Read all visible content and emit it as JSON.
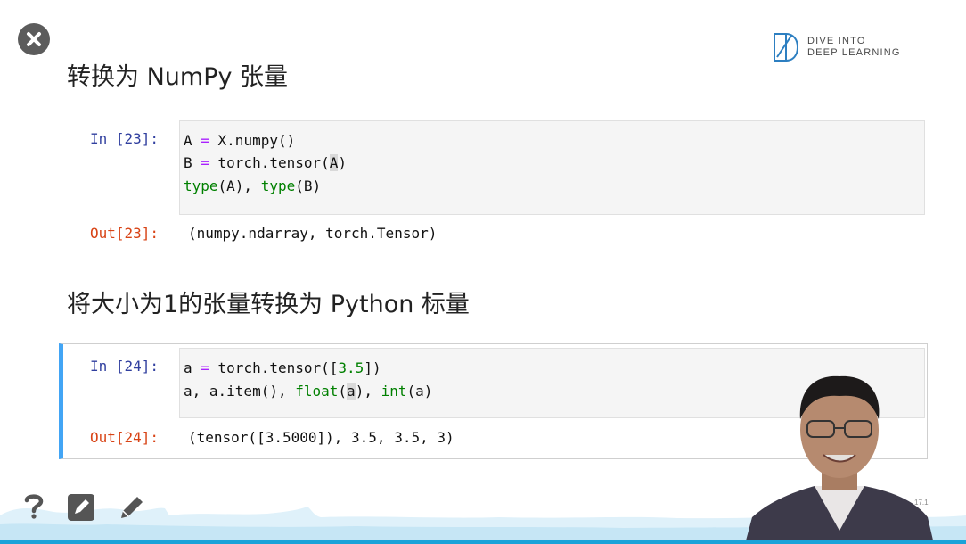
{
  "logo": {
    "line1": "DIVE INTO",
    "line2": "DEEP LEARNING"
  },
  "section1": {
    "heading": "转换为 NumPy 张量"
  },
  "cell23": {
    "in_prompt": "In [23]:",
    "out_prompt": "Out[23]:",
    "output": "(numpy.ndarray, torch.Tensor)",
    "lines": [
      {
        "a": "A ",
        "op": "=",
        "b": " X.numpy()"
      },
      {
        "a": "B ",
        "op": "=",
        "b": " torch.tensor(",
        "hl": "A",
        "c": ")"
      },
      {
        "bi1": "type",
        "m": "(A), ",
        "bi2": "type",
        "e": "(B)"
      }
    ]
  },
  "section2": {
    "heading": "将大小为1的张量转换为 Python 标量"
  },
  "cell24": {
    "in_prompt": "In [24]:",
    "out_prompt": "Out[24]:",
    "output": "(tensor([3.5000]), 3.5, 3.5, 3)",
    "line1": {
      "a": "a ",
      "op": "=",
      "b": " torch.tensor([",
      "num": "3.5",
      "c": "])"
    },
    "line2": {
      "a": "a, a.item(), ",
      "bi1": "float",
      "p1": "(",
      "hl": "a",
      "p2": "), ",
      "bi2": "int",
      "e": "(a)"
    }
  },
  "footer": {
    "slide_number": "17.1"
  },
  "colors": {
    "accent": "#42a5f5",
    "in_prompt": "#303f9f",
    "out_prompt": "#d84315",
    "progress": "#1aa3d9"
  }
}
